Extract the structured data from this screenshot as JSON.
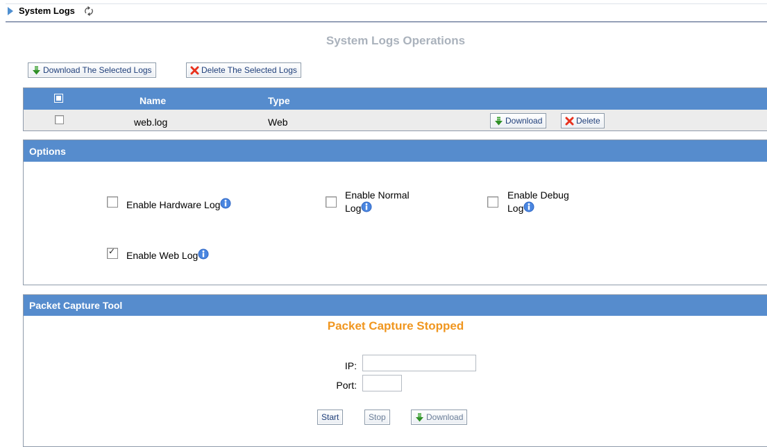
{
  "header": {
    "title": "System Logs"
  },
  "operations": {
    "title": "System Logs Operations",
    "download_selected_label": "Download The Selected Logs",
    "delete_selected_label": "Delete The Selected Logs"
  },
  "log_table": {
    "columns": [
      "Name",
      "Type"
    ],
    "rows": [
      {
        "name": "web.log",
        "type": "Web",
        "download_label": "Download",
        "delete_label": "Delete"
      }
    ]
  },
  "options": {
    "title": "Options",
    "hardware_log": {
      "label": "Enable Hardware Log",
      "checked": false
    },
    "normal_log": {
      "label_line1": "Enable Normal",
      "label_line2": "Log",
      "checked": false
    },
    "debug_log": {
      "label_line1": "Enable Debug",
      "label_line2": "Log",
      "checked": false
    },
    "web_log": {
      "label": "Enable Web Log",
      "checked": true
    }
  },
  "packet_capture": {
    "title": "Packet Capture Tool",
    "status": "Packet Capture Stopped",
    "ip_label": "IP:",
    "ip_value": "",
    "port_label": "Port:",
    "port_value": "",
    "start_label": "Start",
    "stop_label": "Stop",
    "download_label": "Download"
  },
  "colors": {
    "header_blue": "#568ccd",
    "status_orange": "#f0961f",
    "title_gray": "#aab2bc",
    "delete_red": "#e8321e",
    "download_green": "#2e9a2a"
  },
  "icons": {
    "header_arrow": "play-arrow-icon",
    "refresh": "refresh-icon",
    "download": "download-arrow-icon",
    "delete": "delete-x-icon",
    "info": "info-icon"
  }
}
